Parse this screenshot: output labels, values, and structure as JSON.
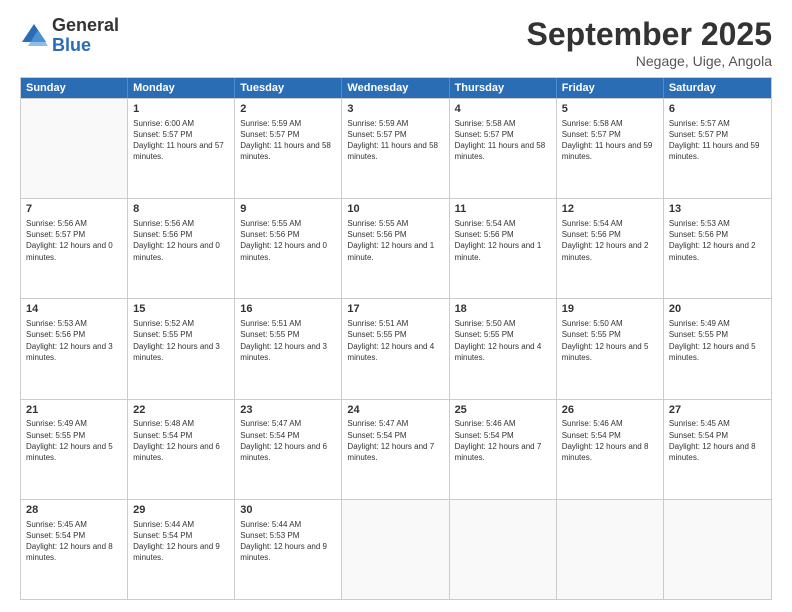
{
  "header": {
    "logo_general": "General",
    "logo_blue": "Blue",
    "month_title": "September 2025",
    "location": "Negage, Uige, Angola"
  },
  "days_of_week": [
    "Sunday",
    "Monday",
    "Tuesday",
    "Wednesday",
    "Thursday",
    "Friday",
    "Saturday"
  ],
  "weeks": [
    [
      {
        "day": "",
        "empty": true
      },
      {
        "day": "1",
        "sunrise": "Sunrise: 6:00 AM",
        "sunset": "Sunset: 5:57 PM",
        "daylight": "Daylight: 11 hours and 57 minutes."
      },
      {
        "day": "2",
        "sunrise": "Sunrise: 5:59 AM",
        "sunset": "Sunset: 5:57 PM",
        "daylight": "Daylight: 11 hours and 58 minutes."
      },
      {
        "day": "3",
        "sunrise": "Sunrise: 5:59 AM",
        "sunset": "Sunset: 5:57 PM",
        "daylight": "Daylight: 11 hours and 58 minutes."
      },
      {
        "day": "4",
        "sunrise": "Sunrise: 5:58 AM",
        "sunset": "Sunset: 5:57 PM",
        "daylight": "Daylight: 11 hours and 58 minutes."
      },
      {
        "day": "5",
        "sunrise": "Sunrise: 5:58 AM",
        "sunset": "Sunset: 5:57 PM",
        "daylight": "Daylight: 11 hours and 59 minutes."
      },
      {
        "day": "6",
        "sunrise": "Sunrise: 5:57 AM",
        "sunset": "Sunset: 5:57 PM",
        "daylight": "Daylight: 11 hours and 59 minutes."
      }
    ],
    [
      {
        "day": "7",
        "sunrise": "Sunrise: 5:56 AM",
        "sunset": "Sunset: 5:57 PM",
        "daylight": "Daylight: 12 hours and 0 minutes."
      },
      {
        "day": "8",
        "sunrise": "Sunrise: 5:56 AM",
        "sunset": "Sunset: 5:56 PM",
        "daylight": "Daylight: 12 hours and 0 minutes."
      },
      {
        "day": "9",
        "sunrise": "Sunrise: 5:55 AM",
        "sunset": "Sunset: 5:56 PM",
        "daylight": "Daylight: 12 hours and 0 minutes."
      },
      {
        "day": "10",
        "sunrise": "Sunrise: 5:55 AM",
        "sunset": "Sunset: 5:56 PM",
        "daylight": "Daylight: 12 hours and 1 minute."
      },
      {
        "day": "11",
        "sunrise": "Sunrise: 5:54 AM",
        "sunset": "Sunset: 5:56 PM",
        "daylight": "Daylight: 12 hours and 1 minute."
      },
      {
        "day": "12",
        "sunrise": "Sunrise: 5:54 AM",
        "sunset": "Sunset: 5:56 PM",
        "daylight": "Daylight: 12 hours and 2 minutes."
      },
      {
        "day": "13",
        "sunrise": "Sunrise: 5:53 AM",
        "sunset": "Sunset: 5:56 PM",
        "daylight": "Daylight: 12 hours and 2 minutes."
      }
    ],
    [
      {
        "day": "14",
        "sunrise": "Sunrise: 5:53 AM",
        "sunset": "Sunset: 5:56 PM",
        "daylight": "Daylight: 12 hours and 3 minutes."
      },
      {
        "day": "15",
        "sunrise": "Sunrise: 5:52 AM",
        "sunset": "Sunset: 5:55 PM",
        "daylight": "Daylight: 12 hours and 3 minutes."
      },
      {
        "day": "16",
        "sunrise": "Sunrise: 5:51 AM",
        "sunset": "Sunset: 5:55 PM",
        "daylight": "Daylight: 12 hours and 3 minutes."
      },
      {
        "day": "17",
        "sunrise": "Sunrise: 5:51 AM",
        "sunset": "Sunset: 5:55 PM",
        "daylight": "Daylight: 12 hours and 4 minutes."
      },
      {
        "day": "18",
        "sunrise": "Sunrise: 5:50 AM",
        "sunset": "Sunset: 5:55 PM",
        "daylight": "Daylight: 12 hours and 4 minutes."
      },
      {
        "day": "19",
        "sunrise": "Sunrise: 5:50 AM",
        "sunset": "Sunset: 5:55 PM",
        "daylight": "Daylight: 12 hours and 5 minutes."
      },
      {
        "day": "20",
        "sunrise": "Sunrise: 5:49 AM",
        "sunset": "Sunset: 5:55 PM",
        "daylight": "Daylight: 12 hours and 5 minutes."
      }
    ],
    [
      {
        "day": "21",
        "sunrise": "Sunrise: 5:49 AM",
        "sunset": "Sunset: 5:55 PM",
        "daylight": "Daylight: 12 hours and 5 minutes."
      },
      {
        "day": "22",
        "sunrise": "Sunrise: 5:48 AM",
        "sunset": "Sunset: 5:54 PM",
        "daylight": "Daylight: 12 hours and 6 minutes."
      },
      {
        "day": "23",
        "sunrise": "Sunrise: 5:47 AM",
        "sunset": "Sunset: 5:54 PM",
        "daylight": "Daylight: 12 hours and 6 minutes."
      },
      {
        "day": "24",
        "sunrise": "Sunrise: 5:47 AM",
        "sunset": "Sunset: 5:54 PM",
        "daylight": "Daylight: 12 hours and 7 minutes."
      },
      {
        "day": "25",
        "sunrise": "Sunrise: 5:46 AM",
        "sunset": "Sunset: 5:54 PM",
        "daylight": "Daylight: 12 hours and 7 minutes."
      },
      {
        "day": "26",
        "sunrise": "Sunrise: 5:46 AM",
        "sunset": "Sunset: 5:54 PM",
        "daylight": "Daylight: 12 hours and 8 minutes."
      },
      {
        "day": "27",
        "sunrise": "Sunrise: 5:45 AM",
        "sunset": "Sunset: 5:54 PM",
        "daylight": "Daylight: 12 hours and 8 minutes."
      }
    ],
    [
      {
        "day": "28",
        "sunrise": "Sunrise: 5:45 AM",
        "sunset": "Sunset: 5:54 PM",
        "daylight": "Daylight: 12 hours and 8 minutes."
      },
      {
        "day": "29",
        "sunrise": "Sunrise: 5:44 AM",
        "sunset": "Sunset: 5:54 PM",
        "daylight": "Daylight: 12 hours and 9 minutes."
      },
      {
        "day": "30",
        "sunrise": "Sunrise: 5:44 AM",
        "sunset": "Sunset: 5:53 PM",
        "daylight": "Daylight: 12 hours and 9 minutes."
      },
      {
        "day": "",
        "empty": true
      },
      {
        "day": "",
        "empty": true
      },
      {
        "day": "",
        "empty": true
      },
      {
        "day": "",
        "empty": true
      }
    ]
  ]
}
